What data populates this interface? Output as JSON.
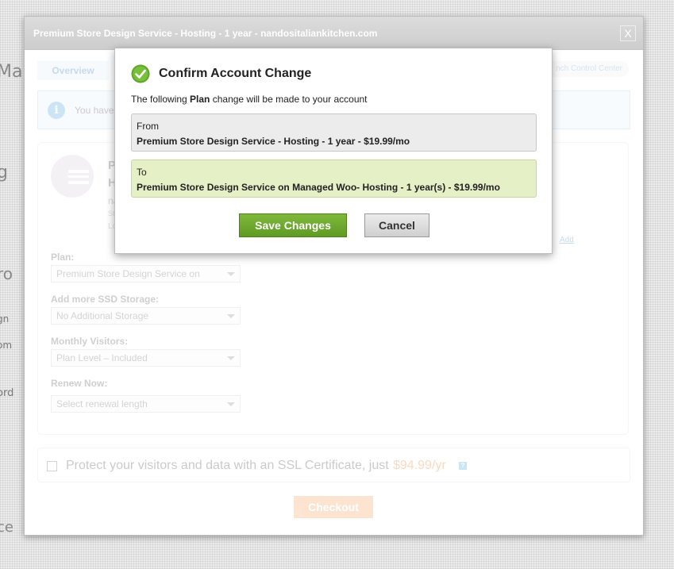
{
  "background": {
    "frag_ma": "Ma",
    "frag_g": "g",
    "frag_ro": "ro",
    "frag_gn": "gn",
    "frag_om": "om",
    "frag_ord": "ord",
    "frag_ce": "ce"
  },
  "main_modal": {
    "title": "Premium Store Design Service - Hosting - 1 year - nandositaliankitchen.com",
    "close_label": "X",
    "tab_overview": "Overview",
    "tab_launch": "nch Control Center",
    "info_text": "You have",
    "product": {
      "line1": "P",
      "line2": "H",
      "sub1": "na",
      "sub2": "St",
      "sub3": "Lo",
      "add_link": "Add"
    },
    "fields": [
      {
        "label": "Plan:",
        "value": "Premium Store Design Service on"
      },
      {
        "label": "Add more SSD Storage:",
        "value": "No Additional Storage"
      },
      {
        "label": "Monthly Visitors:",
        "value": "Plan Level – Included"
      },
      {
        "label": "Renew Now:",
        "value": "Select renewal length"
      }
    ],
    "ssl": {
      "text": "Protect your visitors and data with an SSL Certificate, just",
      "price": "$94.99/yr",
      "help": "?"
    },
    "checkout_label": "Checkout"
  },
  "confirm": {
    "title": "Confirm Account Change",
    "desc_prefix": "The following ",
    "desc_bold": "Plan",
    "desc_suffix": " change will be made to your account",
    "from_label": "From",
    "from_value_pre": "Premium Store Design Service - Hosting - ",
    "from_value_bold": "1 year",
    "from_value_post": " - $19.99/mo",
    "to_label": "To",
    "to_value_pre": "Premium Store Design Service on Managed Woo- Hosting - ",
    "to_value_bold": "1 year(s)",
    "to_value_post": " - $19.99/mo",
    "save_label": "Save Changes",
    "cancel_label": "Cancel"
  },
  "colors": {
    "save_green": "#6aa52e",
    "to_box_bg": "#e6f0c7",
    "ssl_price": "#f07a1a"
  },
  "icons": {
    "confirm": "check-circle-icon",
    "info": "info-icon",
    "product": "cloud-server-icon"
  }
}
